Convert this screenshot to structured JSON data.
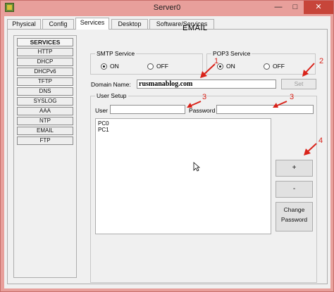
{
  "window": {
    "title": "Server0",
    "minimize": "—",
    "maximize": "□",
    "close": "✕"
  },
  "tabs": [
    {
      "label": "Physical"
    },
    {
      "label": "Config"
    },
    {
      "label": "Services"
    },
    {
      "label": "Desktop"
    },
    {
      "label": "Software/Services"
    }
  ],
  "services": {
    "header": "SERVICES",
    "items": [
      "HTTP",
      "DHCP",
      "DHCPv6",
      "TFTP",
      "DNS",
      "SYSLOG",
      "AAA",
      "NTP",
      "EMAIL",
      "FTP"
    ]
  },
  "email": {
    "title": "EMAIL",
    "smtp": {
      "label": "SMTP Service",
      "on": "ON",
      "off": "OFF",
      "selected": "ON"
    },
    "pop3": {
      "label": "POP3 Service",
      "on": "ON",
      "off": "OFF",
      "selected": "ON"
    },
    "domain_label": "Domain Name:",
    "domain_value": "rusmanablog.com",
    "set_button": "Set",
    "user_setup": {
      "label": "User Setup",
      "user_label": "User",
      "user_value": "",
      "password_label": "Password",
      "password_value": "",
      "users": [
        "PC0",
        "PC1"
      ],
      "add_button": "+",
      "remove_button": "-",
      "change_button_line1": "Change",
      "change_button_line2": "Password"
    }
  },
  "annotations": {
    "n1": "1",
    "n2": "2",
    "n3a": "3",
    "n3b": "3",
    "n4": "4",
    "color": "#d9231a"
  }
}
